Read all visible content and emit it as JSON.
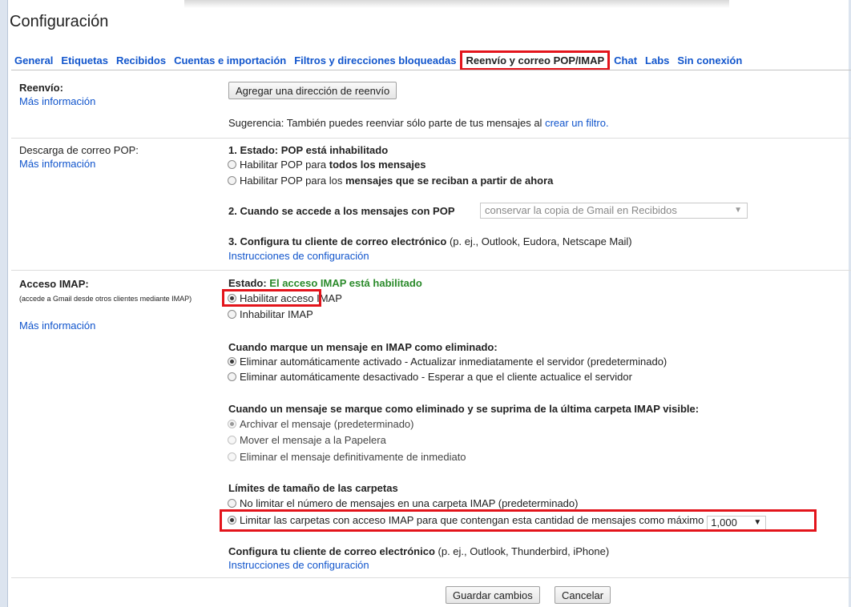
{
  "page": {
    "title": "Configuración"
  },
  "tabs": [
    {
      "label": "General"
    },
    {
      "label": "Etiquetas"
    },
    {
      "label": "Recibidos"
    },
    {
      "label": "Cuentas e importación"
    },
    {
      "label": "Filtros y direcciones bloqueadas"
    },
    {
      "label": "Reenvío y correo POP/IMAP",
      "active": true
    },
    {
      "label": "Chat"
    },
    {
      "label": "Labs"
    },
    {
      "label": "Sin conexión"
    }
  ],
  "forwarding": {
    "label": "Reenvío:",
    "learn_more": "Más información",
    "add_button": "Agregar una dirección de reenvío",
    "tip_prefix": "Sugerencia: También puedes reenviar sólo parte de tus mensajes al",
    "tip_link": "crear un filtro."
  },
  "pop": {
    "label": "Descarga de correo POP:",
    "learn_more": "Más información",
    "status": "1. Estado: POP está inhabilitado",
    "option_all_prefix": "Habilitar POP para",
    "option_all_bold": "todos los mensajes",
    "option_new_prefix": "Habilitar POP para los",
    "option_new_bold": "mensajes que se reciban a partir de ahora",
    "access_label": "2. Cuando se accede a los mensajes con POP",
    "access_select": "conservar la copia de Gmail en Recibidos",
    "client_bold": "3. Configura tu cliente de correo electrónico",
    "client_rest": "(p. ej., Outlook, Eudora, Netscape Mail)",
    "instructions": "Instrucciones de configuración"
  },
  "imap": {
    "label": "Acceso IMAP:",
    "sublabel": "(accede a Gmail desde otros clientes mediante IMAP)",
    "learn_more": "Más información",
    "status_label": "Estado:",
    "status_value": "El acceso IMAP está habilitado",
    "enable": "Habilitar acceso IMAP",
    "disable": "Inhabilitar IMAP",
    "deleted_heading": "Cuando marque un mensaje en IMAP como eliminado:",
    "auto_expunge_on": "Eliminar automáticamente activado - Actualizar inmediatamente el servidor (predeterminado)",
    "auto_expunge_off": "Eliminar automáticamente desactivado - Esperar a que el cliente actualice el servidor",
    "expunge_heading": "Cuando un mensaje se marque como eliminado y se suprima de la última carpeta IMAP visible:",
    "archive": "Archivar el mensaje (predeterminado)",
    "trash": "Mover el mensaje a la Papelera",
    "delete_forever": "Eliminar el mensaje definitivamente de inmediato",
    "limits_heading": "Límites de tamaño de las carpetas",
    "no_limit": "No limitar el número de mensajes en una carpeta IMAP (predeterminado)",
    "limit": "Limitar las carpetas con acceso IMAP para que contengan esta cantidad de mensajes como máximo",
    "limit_value": "1,000",
    "client_bold": "Configura tu cliente de correo electrónico",
    "client_rest": "(p. ej., Outlook, Thunderbird, iPhone)",
    "instructions": "Instrucciones de configuración"
  },
  "footer": {
    "save": "Guardar cambios",
    "cancel": "Cancelar"
  },
  "colors": {
    "link": "#1155cc",
    "highlight": "#e3141b",
    "status_green": "#2a8a2a"
  }
}
